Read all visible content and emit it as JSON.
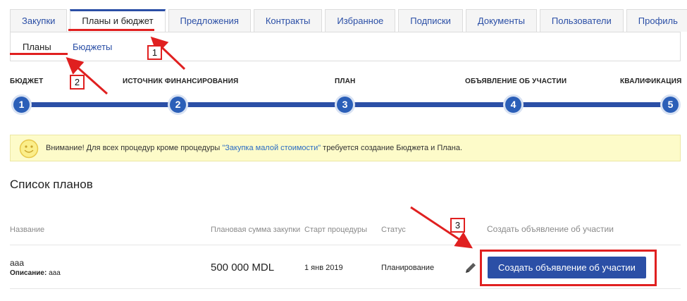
{
  "tabs": [
    {
      "label": "Закупки",
      "active": false
    },
    {
      "label": "Планы и бюджет",
      "active": true
    },
    {
      "label": "Предложения",
      "active": false
    },
    {
      "label": "Контракты",
      "active": false
    },
    {
      "label": "Избранное",
      "active": false
    },
    {
      "label": "Подписки",
      "active": false
    },
    {
      "label": "Документы",
      "active": false
    },
    {
      "label": "Пользователи",
      "active": false
    },
    {
      "label": "Профиль",
      "active": false
    }
  ],
  "subtabs": {
    "plans": "Планы",
    "budgets": "Бюджеты"
  },
  "steps": [
    {
      "number": "1",
      "label": "БЮДЖЕТ"
    },
    {
      "number": "2",
      "label": "ИСТОЧНИК ФИНАНСИРОВАНИЯ"
    },
    {
      "number": "3",
      "label": "ПЛАН"
    },
    {
      "number": "4",
      "label": "ОБЪЯВЛЕНИЕ ОБ УЧАСТИИ"
    },
    {
      "number": "5",
      "label": "КВАЛИФИКАЦИЯ"
    }
  ],
  "notice": {
    "prefix": "Внимание! Для всех процедур кроме процедуры ",
    "link": "\"Закупка малой стоимости\"",
    "suffix": " требуется создание Бюджета и Плана."
  },
  "plans_list": {
    "title": "Список планов",
    "columns": {
      "name": "Название",
      "amount": "Плановая сумма закупки",
      "start": "Старт процедуры",
      "status": "Статус",
      "create": "Создать объявление об участии"
    },
    "rows": [
      {
        "name": "aaa",
        "description_label": "Описание:",
        "description_value": "aaa",
        "amount": "500 000 MDL",
        "start": "1 янв 2019",
        "status": "Планирование",
        "button_label": "Создать объявление об участии"
      }
    ]
  },
  "annotations": {
    "badge1": "1",
    "badge2": "2",
    "badge3": "3"
  },
  "colors": {
    "accent": "#2b4fa6",
    "annotation": "#e02020",
    "notice_bg": "#fdfbc9"
  }
}
